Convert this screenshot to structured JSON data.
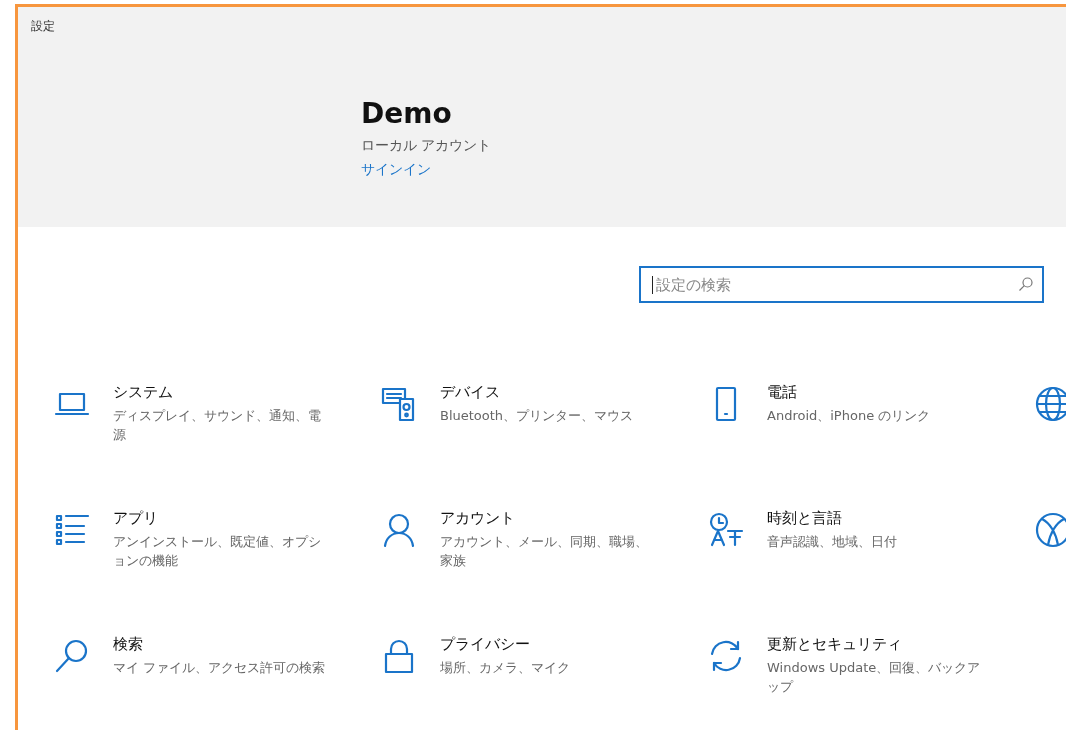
{
  "window": {
    "title": "設定"
  },
  "account": {
    "name": "Demo",
    "type": "ローカル アカウント",
    "link": "サインイン"
  },
  "search": {
    "placeholder": "設定の検索"
  },
  "categories": [
    {
      "kind": "full",
      "title": "システム",
      "subtitle": "ディスプレイ、サウンド、通知、電源"
    },
    {
      "kind": "full",
      "title": "デバイス",
      "subtitle": "Bluetooth、プリンター、マウス"
    },
    {
      "kind": "full",
      "title": "電話",
      "subtitle": "Android、iPhone のリンク"
    },
    {
      "kind": "cut"
    },
    {
      "kind": "full",
      "title": "アプリ",
      "subtitle": "アンインストール、既定値、オプションの機能"
    },
    {
      "kind": "full",
      "title": "アカウント",
      "subtitle": "アカウント、メール、同期、職場、家族"
    },
    {
      "kind": "full",
      "title": "時刻と言語",
      "subtitle": "音声認識、地域、日付"
    },
    {
      "kind": "cut"
    },
    {
      "kind": "full",
      "title": "検索",
      "subtitle": "マイ ファイル、アクセス許可の検索"
    },
    {
      "kind": "full",
      "title": "プライバシー",
      "subtitle": "場所、カメラ、マイク"
    },
    {
      "kind": "full",
      "title": "更新とセキュリティ",
      "subtitle": "Windows Update、回復、バックアップ"
    }
  ]
}
